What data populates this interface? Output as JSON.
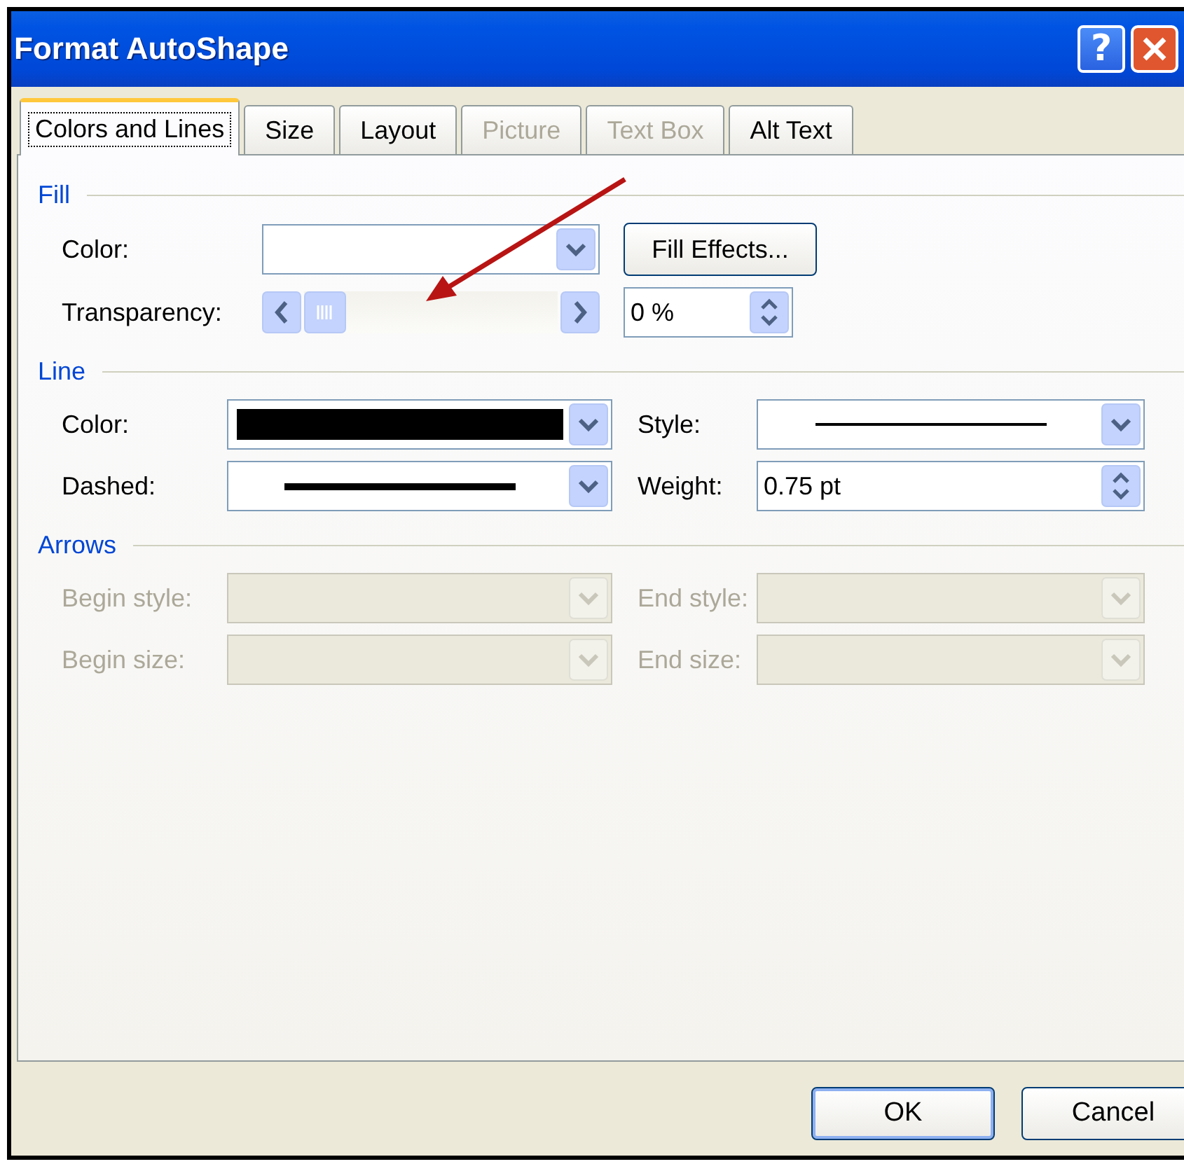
{
  "window": {
    "title": "Format AutoShape",
    "help_button": "?"
  },
  "tabs": [
    {
      "label": "Colors and Lines",
      "selected": true,
      "disabled": false
    },
    {
      "label": "Size",
      "selected": false,
      "disabled": false
    },
    {
      "label": "Layout",
      "selected": false,
      "disabled": false
    },
    {
      "label": "Picture",
      "selected": false,
      "disabled": true
    },
    {
      "label": "Text Box",
      "selected": false,
      "disabled": true
    },
    {
      "label": "Alt Text",
      "selected": false,
      "disabled": false
    }
  ],
  "fill": {
    "heading": "Fill",
    "color": {
      "label": "Color:"
    },
    "fill_effects_button": "Fill Effects...",
    "transparency": {
      "label": "Transparency:",
      "level": 0,
      "value": "0 %"
    }
  },
  "line": {
    "heading": "Line",
    "fields": [
      {
        "label": "Color:",
        "kind": "color",
        "color": "#000000"
      },
      {
        "label": "Style:",
        "kind": "thin-line"
      },
      {
        "label": "Dashed:",
        "kind": "thick-line"
      },
      {
        "label": "Weight:",
        "kind": "spin",
        "value": "0.75 pt"
      }
    ]
  },
  "arrows": {
    "heading": "Arrows",
    "disabled": true,
    "fields": [
      {
        "label": "Begin style:"
      },
      {
        "label": "End style:"
      },
      {
        "label": "Begin size:"
      },
      {
        "label": "End size:"
      }
    ]
  },
  "buttons": [
    {
      "label": "OK",
      "default": true
    },
    {
      "label": "Cancel",
      "default": false
    }
  ]
}
